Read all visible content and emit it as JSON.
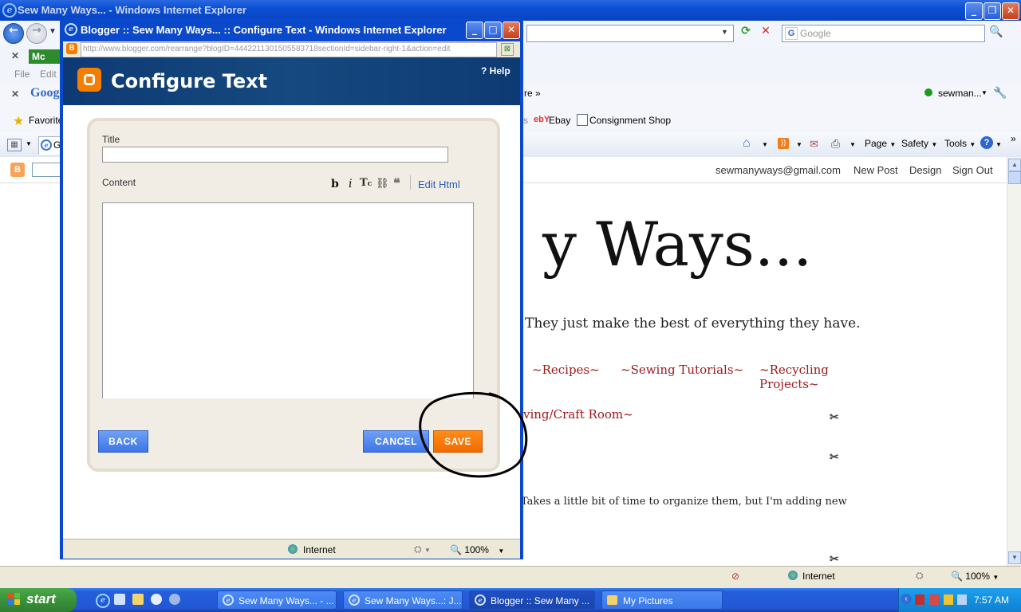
{
  "main_window": {
    "title": "Sew Many Ways... - Windows Internet Explorer",
    "search_placeholder": "Google",
    "menu": [
      "File",
      "Edit"
    ],
    "mcafee_label": "Mc",
    "google_toolbar_label": "Goog",
    "more_label": "re »",
    "user_label": "sewman...",
    "favorites_label": "Favorite",
    "fav_links": [
      "Ebay",
      "Consignment Shop"
    ],
    "tab_label": "G",
    "cmd_buttons": [
      "Page",
      "Safety",
      "Tools"
    ]
  },
  "blogger_bar": {
    "email": "sewmanyways@gmail.com",
    "links": [
      "New Post",
      "Design",
      "Sign Out"
    ]
  },
  "blog": {
    "title_fragment": "y Ways...",
    "tagline_fragment": "They just make the best of everything they have.",
    "nav_links": [
      "~Recipes~",
      "~Sewing Tutorials~",
      "~Recycling Projects~"
    ],
    "nav_link_2": "ving/Craft Room~",
    "body_fragment": "Takes a little bit of time to organize them, but I'm adding new"
  },
  "main_status": {
    "zone": "Internet",
    "zoom": "100%"
  },
  "popup": {
    "title": "Blogger :: Sew Many Ways... :: Configure Text - Windows Internet Explorer",
    "url": "http://www.blogger.com/rearrange?blogID=4442211301505583718sectionId=sidebar-right-1&action=edit",
    "header_title": "Configure Text",
    "help_label": "? Help",
    "title_label": "Title",
    "title_value": "",
    "content_label": "Content",
    "edit_html_label": "Edit Html",
    "back_label": "BACK",
    "cancel_label": "CANCEL",
    "save_label": "SAVE",
    "status_zone": "Internet",
    "status_zoom": "100%"
  },
  "taskbar": {
    "start_label": "start",
    "tasks": [
      "Sew Many Ways... - ...",
      "Sew Many Ways...: J...",
      "Blogger :: Sew Many ...",
      "My Pictures"
    ],
    "clock": "7:57 AM"
  },
  "colors": {
    "xp_blue": "#0a49cc",
    "blogger_orange": "#f57d00",
    "header_navy": "#0e3a73",
    "link_red": "#a01818"
  }
}
